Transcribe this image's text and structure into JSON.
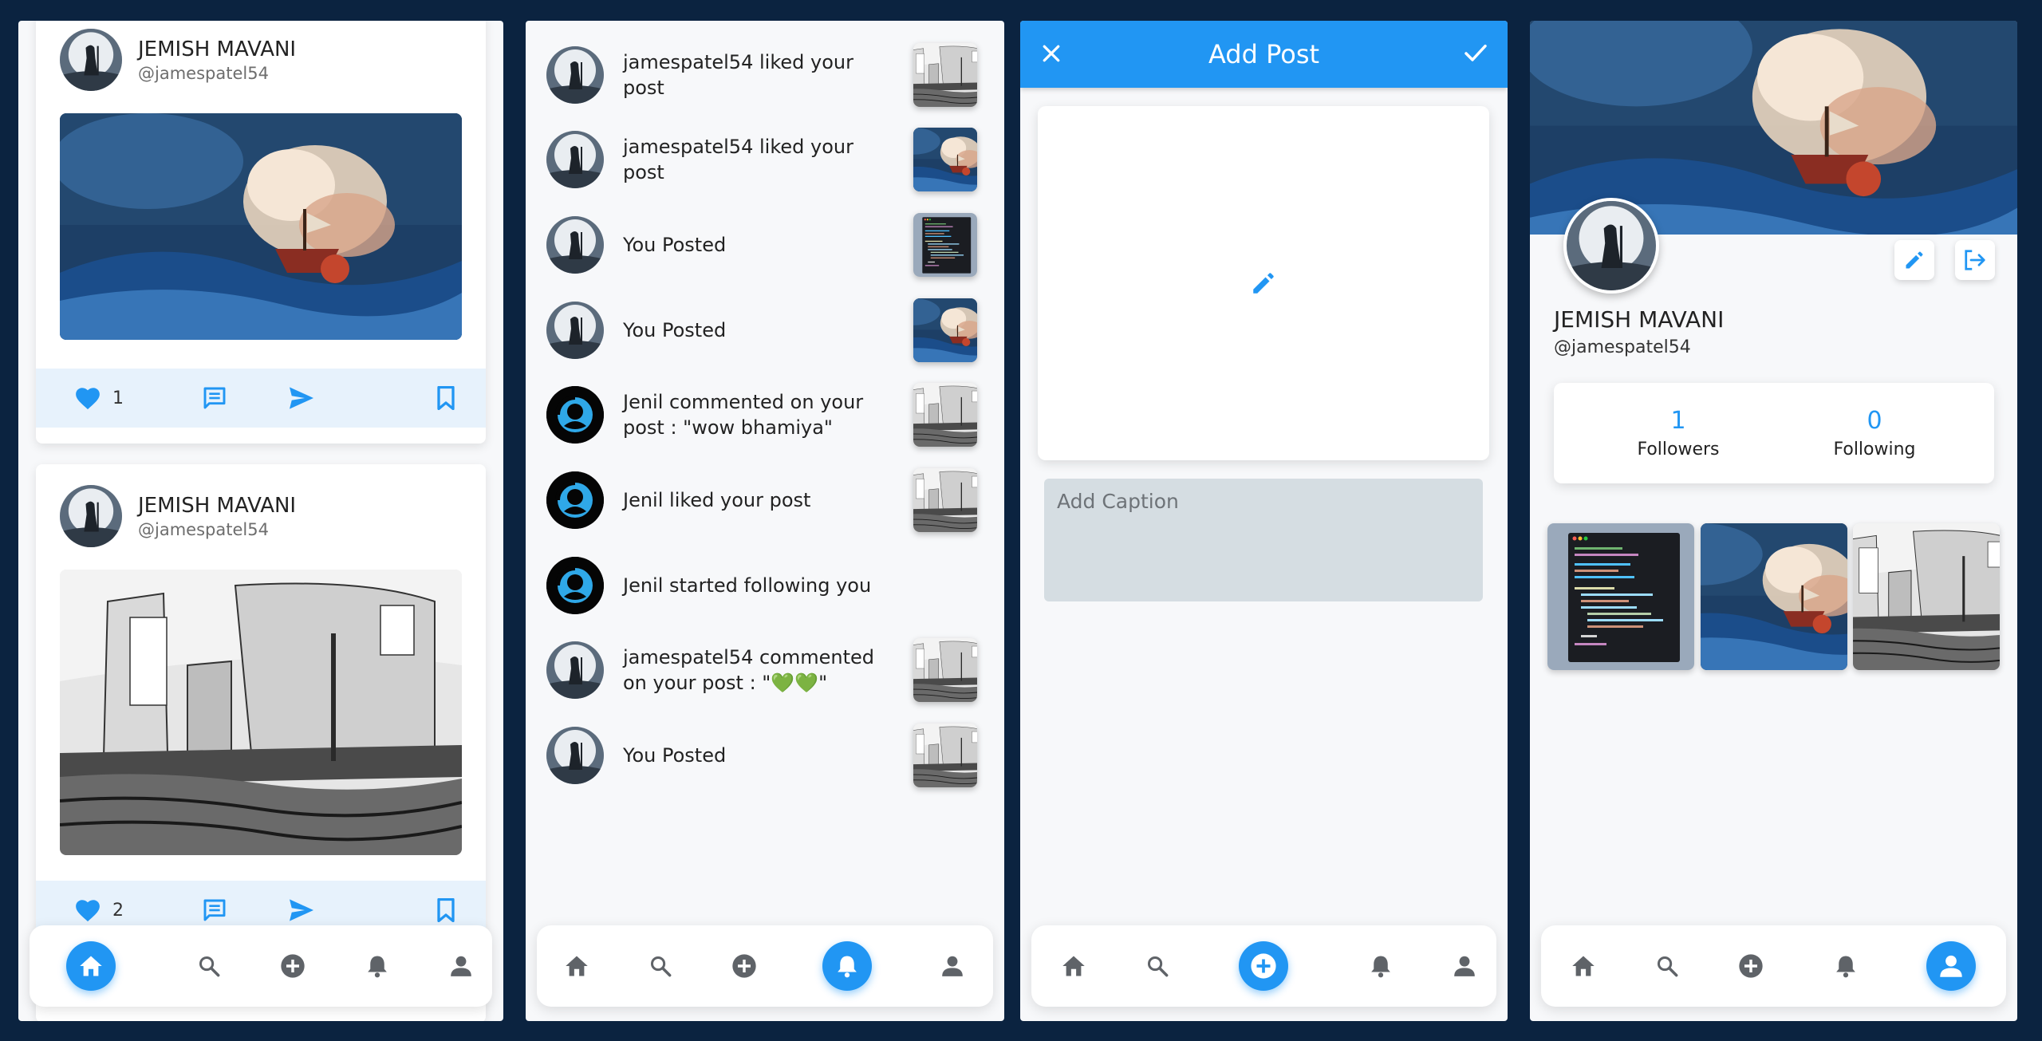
{
  "feed": {
    "posts": [
      {
        "name": "JEMISH MAVANI",
        "handle": "@jamespatel54",
        "image": "stormy-sea-ship-art",
        "likes": "1"
      },
      {
        "name": "JEMISH MAVANI",
        "handle": "@jamespatel54",
        "image": "viking-ships-sketch",
        "likes": "2"
      }
    ]
  },
  "nav": {
    "items": [
      "home-icon",
      "search-icon",
      "add-circle-icon",
      "bell-icon",
      "person-icon"
    ],
    "accent": "#2196f3"
  },
  "notifications": {
    "items": [
      {
        "text": "jamespatel54 liked your post",
        "thumb": "viking-ships-sketch"
      },
      {
        "text": "jamespatel54 liked your post",
        "thumb": "stormy-sea-ship-art"
      },
      {
        "text": "You Posted",
        "thumb": "code-screenshot"
      },
      {
        "text": "You Posted",
        "thumb": "stormy-sea-ship-art"
      },
      {
        "text": "Jenil commented on your post : \"wow bhamiya\"",
        "thumb": "viking-ships-sketch"
      },
      {
        "text": "Jenil liked your post",
        "thumb": "viking-ships-sketch"
      },
      {
        "text": "Jenil started following you",
        "thumb": ""
      },
      {
        "text": "jamespatel54 commented on your post : \"💚💚\"",
        "thumb": "viking-ships-sketch"
      },
      {
        "text": "You Posted",
        "thumb": "viking-ships-sketch"
      }
    ]
  },
  "add_post": {
    "title": "Add Post",
    "caption_placeholder": "Add Caption"
  },
  "profile": {
    "name": "JEMISH MAVANI",
    "handle": "@jamespatel54",
    "followers_count": "1",
    "followers_label": "Followers",
    "following_count": "0",
    "following_label": "Following",
    "grid": [
      "code-screenshot",
      "stormy-sea-ship-art",
      "viking-ships-sketch"
    ]
  }
}
